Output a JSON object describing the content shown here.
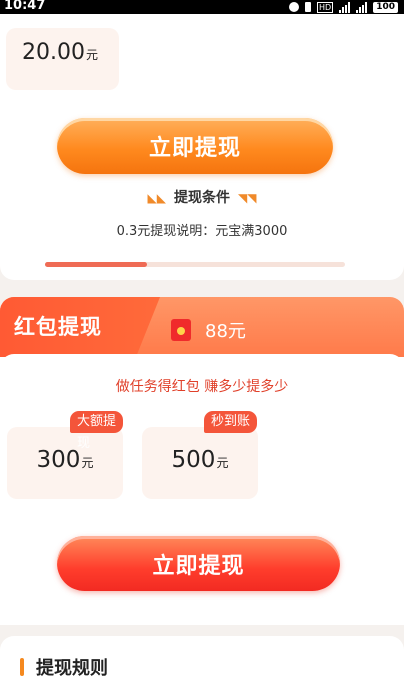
{
  "status_bar": {
    "time": "10:47",
    "network_label": "HD",
    "battery": "100"
  },
  "withdraw_card": {
    "amount_value": "20.00",
    "amount_unit": "元",
    "button_label": "立即提现",
    "condition_title": "提现条件",
    "condition_desc": "0.3元提现说明：元宝满3000",
    "progress_fraction": 0.34
  },
  "red_packet": {
    "header_title": "红包提现",
    "header_amount": "88元",
    "slogan": "做任务得红包 赚多少提多少",
    "options": [
      {
        "badge": "大额提现",
        "value": "300",
        "unit": "元"
      },
      {
        "badge": "秒到账",
        "value": "500",
        "unit": "元"
      }
    ],
    "button_label": "立即提现"
  },
  "rules": {
    "title": "提现规则"
  },
  "colors": {
    "accent_orange": "#ff8a1f",
    "accent_red": "#f4553a",
    "progress": "#ef6b55"
  }
}
